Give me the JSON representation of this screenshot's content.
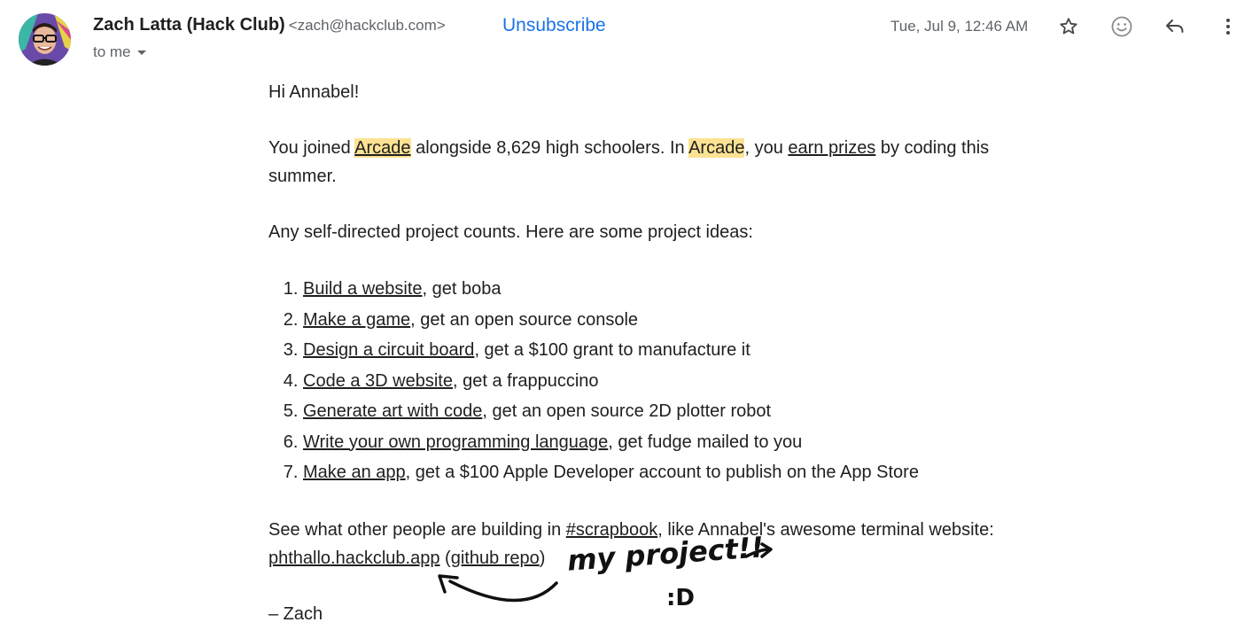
{
  "header": {
    "sender_name": "Zach Latta (Hack Club)",
    "sender_email": "<zach@hackclub.com>",
    "unsubscribe_label": "Unsubscribe",
    "recipient": "to me",
    "date": "Tue, Jul 9, 12:46 AM",
    "icons": [
      "star-icon",
      "emoji-icon",
      "reply-icon",
      "more-vert-icon"
    ]
  },
  "body": {
    "greeting": "Hi Annabel!",
    "p1": {
      "a": "You joined ",
      "arcade1": "Arcade",
      "b": " alongside 8,629 high schoolers. In ",
      "arcade2": "Arcade",
      "c": ", you ",
      "earn_prizes": "earn prizes",
      "d": " by coding this summer."
    },
    "p2": "Any self-directed project counts. Here are some project ideas:",
    "ideas": [
      {
        "link": "Build a website",
        "rest": ", get boba"
      },
      {
        "link": "Make a game",
        "rest": ", get an open source console"
      },
      {
        "link": "Design a circuit board",
        "rest": ", get a $100 grant to manufacture it"
      },
      {
        "link": "Code a 3D website",
        "rest": ", get a frappuccino"
      },
      {
        "link": "Generate art with code",
        "rest": ", get an open source 2D plotter robot"
      },
      {
        "link": "Write your own programming language",
        "rest": ", get fudge mailed to you"
      },
      {
        "link": "Make an app",
        "rest": ", get a $100 Apple Developer account to publish on the App Store"
      }
    ],
    "p3": {
      "a": "See what other people are building in ",
      "scrapbook": "#scrapbook",
      "b": ", like Annabel's awesome terminal website: ",
      "site": "phthallo.hackclub.app",
      "c": " (",
      "repo": "github repo",
      "d": ")"
    },
    "signoff": "– Zach"
  },
  "annotation": {
    "text": "my project!!",
    "smile": ":D"
  },
  "colors": {
    "highlight": "#fde293",
    "link_blue": "#1a73e8",
    "muted": "#5f6368"
  }
}
